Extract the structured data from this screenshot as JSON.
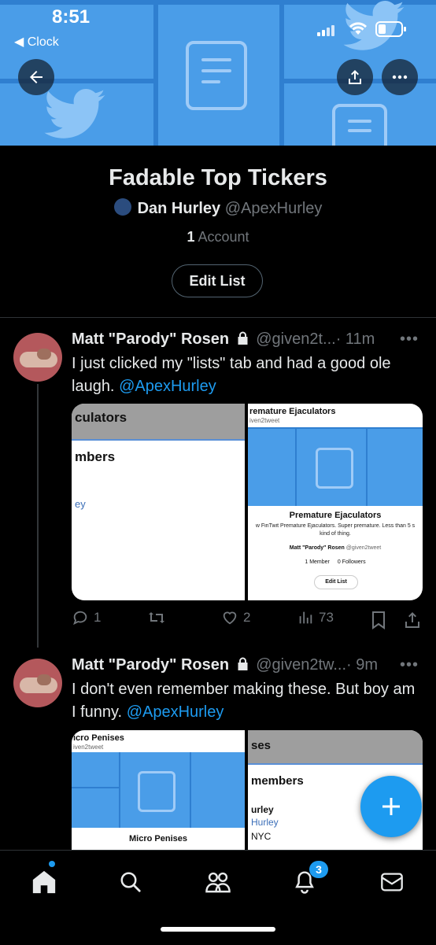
{
  "status": {
    "time": "8:51",
    "back_app": "◀ Clock"
  },
  "list": {
    "title": "Fadable Top Tickers",
    "owner_name": "Dan Hurley",
    "owner_handle": "@ApexHurley",
    "member_count": "1",
    "member_label": "Account",
    "edit_label": "Edit List"
  },
  "tweets": [
    {
      "name": "Matt \"Parody\" Rosen",
      "handle": "@given2t...",
      "time": "· 11m",
      "text": "I just clicked my \"lists\" tab and had a good ole laugh.",
      "mention": "@ApexHurley",
      "media_left": {
        "title": "culators",
        "sub": "mbers",
        "tail": "ey"
      },
      "media_right": {
        "header": "remature Ejaculators",
        "header_sub": "iven2tweet",
        "list_name": "Premature Ejaculators",
        "desc": "w FinTwit Premature Ejaculators. Super premature. Less than 5 s",
        "desc2": "kind of thing.",
        "owner": "Matt \"Parody\" Rosen",
        "owner_handle": "@given2tweet",
        "members": "1 Member",
        "followers": "0 Followers",
        "button": "Edit List"
      },
      "replies": "1",
      "reposts": "",
      "likes": "2",
      "views": "73"
    },
    {
      "name": "Matt \"Parody\" Rosen",
      "handle": "@given2tw...",
      "time": "· 9m",
      "text": "I don't even remember making these.  But boy am I funny.",
      "mention": "@ApexHurley",
      "media_left": {
        "header": "icro Penises",
        "header_sub": "iven2tweet",
        "list_name": "Micro Penises"
      },
      "media_right": {
        "header": "ses",
        "sub": "members",
        "l1": "urley",
        "l2": "Hurley",
        "l3": "NYC"
      }
    }
  ],
  "tabbar": {
    "notifications_badge": "3"
  },
  "colors": {
    "accent": "#1d9bf0",
    "banner": "#4a9de8",
    "muted": "#71767b"
  }
}
